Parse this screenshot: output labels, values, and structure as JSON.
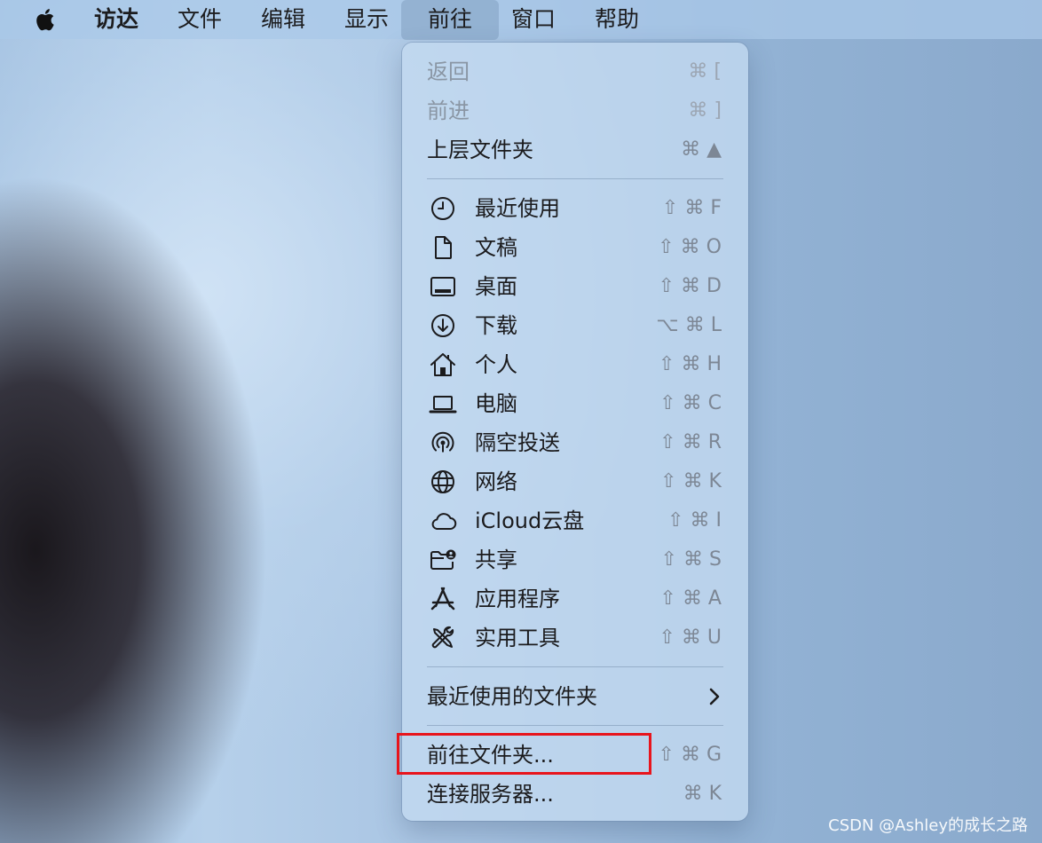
{
  "menubar": {
    "apple_icon": "apple-logo-icon",
    "items": [
      {
        "label": "访达"
      },
      {
        "label": "文件"
      },
      {
        "label": "编辑"
      },
      {
        "label": "显示"
      },
      {
        "label": "前往"
      },
      {
        "label": "窗口"
      },
      {
        "label": "帮助"
      }
    ]
  },
  "menu": {
    "top_items": [
      {
        "label": "返回",
        "shortcut": "⌘ [",
        "disabled": true
      },
      {
        "label": "前进",
        "shortcut": "⌘ ]",
        "disabled": true
      },
      {
        "label": "上层文件夹",
        "shortcut": "⌘ ▲",
        "disabled": false
      }
    ],
    "places": [
      {
        "label": "最近使用",
        "shortcut": "⇧ ⌘ F",
        "icon": "clock-icon"
      },
      {
        "label": "文稿",
        "shortcut": "⇧ ⌘ O",
        "icon": "document-icon"
      },
      {
        "label": "桌面",
        "shortcut": "⇧ ⌘ D",
        "icon": "desktop-icon"
      },
      {
        "label": "下载",
        "shortcut": "⌥ ⌘ L",
        "icon": "download-icon"
      },
      {
        "label": "个人",
        "shortcut": "⇧ ⌘ H",
        "icon": "home-icon"
      },
      {
        "label": "电脑",
        "shortcut": "⇧ ⌘ C",
        "icon": "laptop-icon"
      },
      {
        "label": "隔空投送",
        "shortcut": "⇧ ⌘ R",
        "icon": "airdrop-icon"
      },
      {
        "label": "网络",
        "shortcut": "⇧ ⌘ K",
        "icon": "globe-icon"
      },
      {
        "label": "iCloud云盘",
        "shortcut": "⇧ ⌘ I",
        "icon": "cloud-icon"
      },
      {
        "label": "共享",
        "shortcut": "⇧ ⌘ S",
        "icon": "shared-folder-icon"
      },
      {
        "label": "应用程序",
        "shortcut": "⇧ ⌘ A",
        "icon": "app-store-icon"
      },
      {
        "label": "实用工具",
        "shortcut": "⇧ ⌘ U",
        "icon": "tools-icon"
      }
    ],
    "recent_folders": {
      "label": "最近使用的文件夹"
    },
    "bottom_items": [
      {
        "label": "前往文件夹...",
        "shortcut": "⇧ ⌘ G"
      },
      {
        "label": "连接服务器...",
        "shortcut": "⌘ K"
      }
    ]
  },
  "annotation_color": "#e8141c",
  "watermark": "CSDN @Ashley的成长之路"
}
